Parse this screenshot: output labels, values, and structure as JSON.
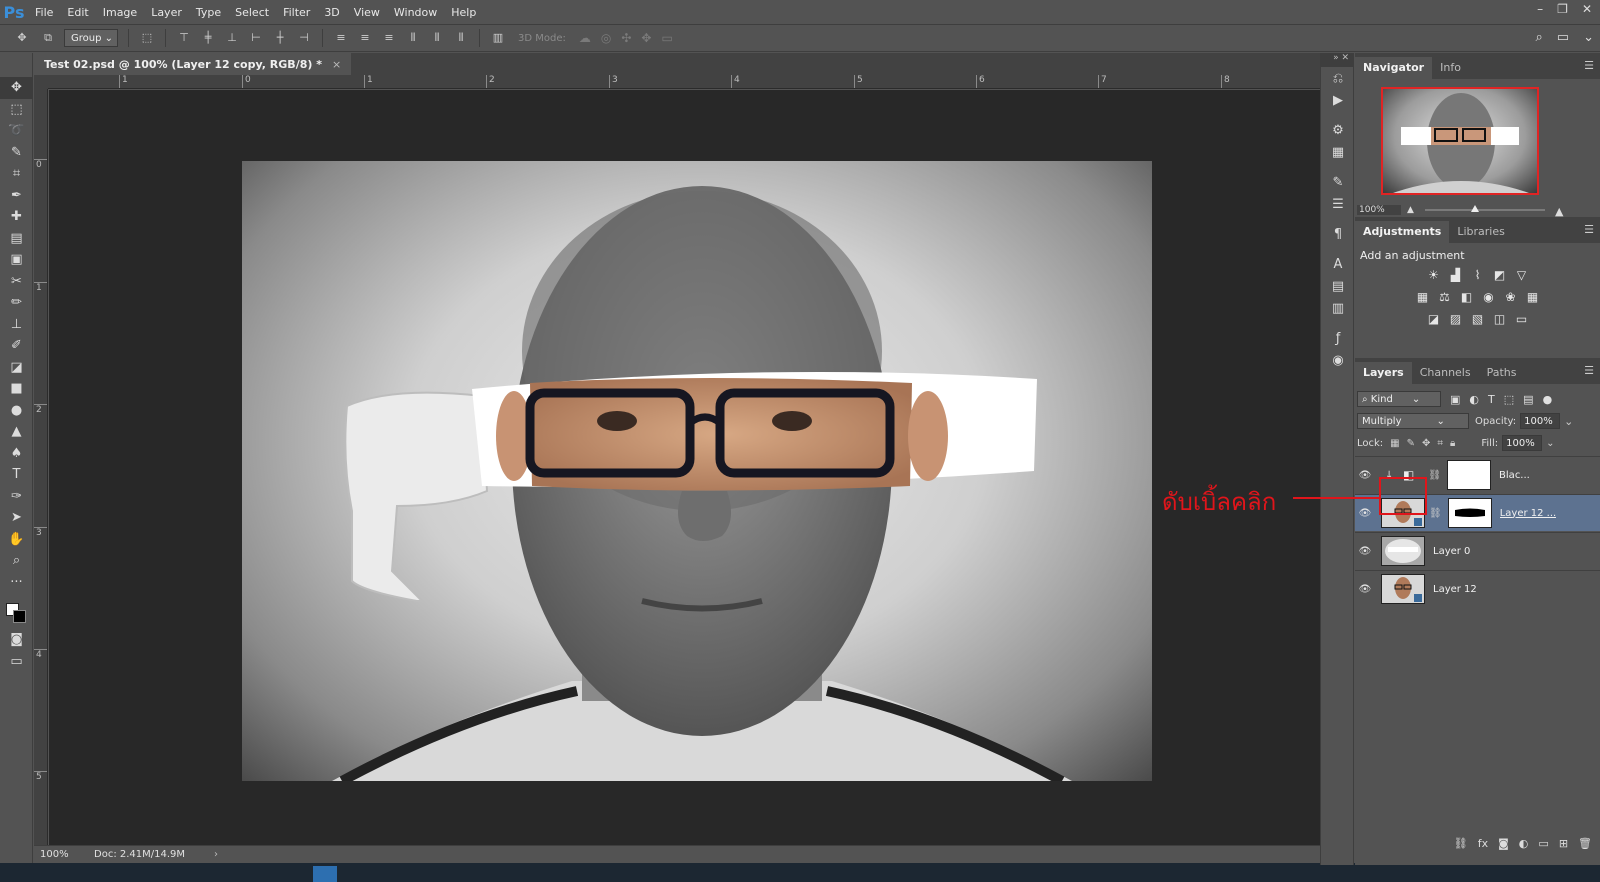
{
  "app": {
    "logo": "Ps"
  },
  "menu": [
    "File",
    "Edit",
    "Image",
    "Layer",
    "Type",
    "Select",
    "Filter",
    "3D",
    "View",
    "Window",
    "Help"
  ],
  "window_controls": {
    "minimize": "–",
    "restore": "❐",
    "close": "✕"
  },
  "options_bar": {
    "auto_select_value": "Group",
    "mode3d_label": "3D Mode:"
  },
  "document": {
    "tab_title": "Test 02.psd @ 100% (Layer 12 copy, RGB/8) *",
    "tab_close": "×"
  },
  "rulers": {
    "top": [
      "1",
      "0",
      "1",
      "2",
      "3",
      "4",
      "5",
      "6",
      "7",
      "8"
    ],
    "left": [
      "0",
      "1",
      "2",
      "3",
      "4",
      "5"
    ]
  },
  "status": {
    "zoom": "100%",
    "doc": "Doc: 2.41M/14.9M",
    "arrow": "›"
  },
  "navigator": {
    "tabs": [
      {
        "label": "Navigator",
        "active": true
      },
      {
        "label": "Info",
        "active": false
      }
    ],
    "zoom_value": "100%"
  },
  "adjustments": {
    "tabs": [
      {
        "label": "Adjustments",
        "active": true
      },
      {
        "label": "Libraries",
        "active": false
      }
    ],
    "title": "Add an adjustment"
  },
  "layers_panel": {
    "tabs": [
      {
        "label": "Layers",
        "active": true
      },
      {
        "label": "Channels",
        "active": false
      },
      {
        "label": "Paths",
        "active": false
      }
    ],
    "filter_kind": "Kind",
    "blend_mode": "Multiply",
    "opacity_label": "Opacity:",
    "opacity_value": "100%",
    "lock_label": "Lock:",
    "fill_label": "Fill:",
    "fill_value": "100%",
    "layers": [
      {
        "name": "Blac...",
        "type": "adjustment",
        "selected": false,
        "visible": true
      },
      {
        "name": "Layer 12 ...",
        "type": "smart_object_mask",
        "selected": true,
        "visible": true
      },
      {
        "name": "Layer 0",
        "type": "raster",
        "selected": false,
        "visible": true
      },
      {
        "name": "Layer 12",
        "type": "smart_object",
        "selected": false,
        "visible": true
      }
    ]
  },
  "annotation": {
    "text": "ดับเบิ้ลคลิก",
    "color": "#e0151b"
  },
  "colors": {
    "accent_red": "#e0151b",
    "selected_layer": "#5d7290",
    "ps_blue": "#3b8fd9"
  }
}
